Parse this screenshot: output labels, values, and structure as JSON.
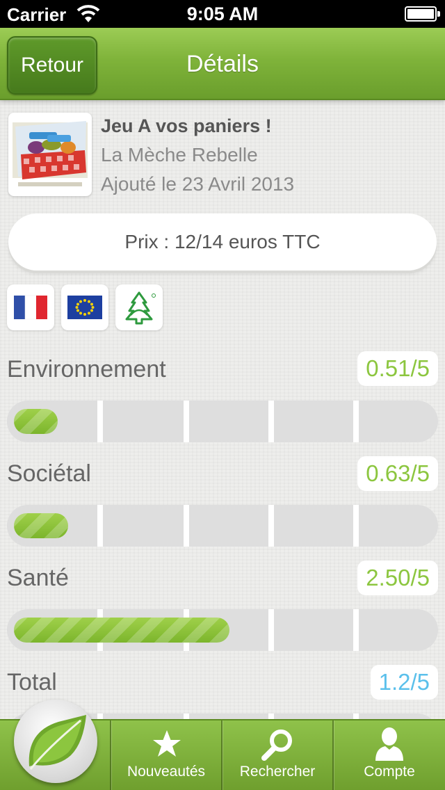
{
  "status_bar": {
    "carrier": "Carrier",
    "time": "9:05 AM"
  },
  "nav": {
    "back_label": "Retour",
    "title": "Détails"
  },
  "product": {
    "name": "Jeu A vos paniers !",
    "brand": "La Mèche Rebelle",
    "added": "Ajouté le 23 Avril 2013",
    "price": "Prix : 12/14 euros TTC"
  },
  "badges": [
    "france-flag-icon",
    "eu-flag-icon",
    "fsc-tree-icon"
  ],
  "metrics": [
    {
      "label": "Environnement",
      "value": "0.51/5",
      "score": 0.51,
      "color": "#8cc63f"
    },
    {
      "label": "Sociétal",
      "value": "0.63/5",
      "score": 0.63,
      "color": "#8cc63f"
    },
    {
      "label": "Santé",
      "value": "2.50/5",
      "score": 2.5,
      "color": "#8cc63f"
    },
    {
      "label": "Total",
      "value": "1.2/5",
      "score": 1.2,
      "color": "#5bc0eb"
    }
  ],
  "tabs": [
    {
      "label": "Nouveautés",
      "icon": "star-icon"
    },
    {
      "label": "Rechercher",
      "icon": "search-icon"
    },
    {
      "label": "Compte",
      "icon": "person-icon"
    }
  ]
}
